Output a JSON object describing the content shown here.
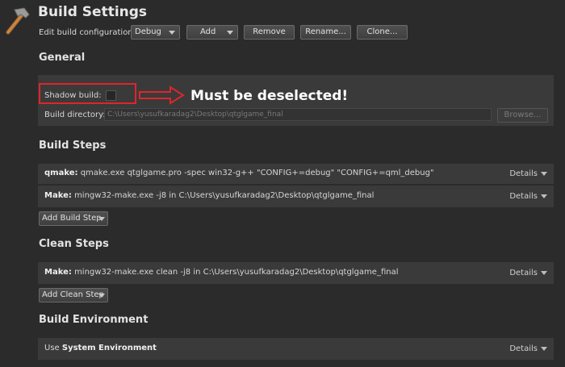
{
  "header": {
    "title": "Build Settings",
    "config_label": "Edit build configuration:",
    "config_value": "Debug",
    "add_label": "Add",
    "remove_label": "Remove",
    "rename_label": "Rename...",
    "clone_label": "Clone..."
  },
  "general": {
    "heading": "General",
    "shadow_build_label": "Shadow build:",
    "shadow_build_checked": false,
    "build_dir_label": "Build directory:",
    "build_dir_value": "C:\\Users\\yusufkaradag2\\Desktop\\qtglgame_final",
    "browse_label": "Browse..."
  },
  "annotation": {
    "callout_text": "Must be deselected!",
    "color": "#e0252b"
  },
  "build_steps": {
    "heading": "Build Steps",
    "steps": [
      {
        "name": "qmake:",
        "command": "qmake.exe qtglgame.pro -spec win32-g++ \"CONFIG+=debug\" \"CONFIG+=qml_debug\"",
        "details": "Details"
      },
      {
        "name": "Make:",
        "command": "mingw32-make.exe -j8 in C:\\Users\\yusufkaradag2\\Desktop\\qtglgame_final",
        "details": "Details"
      }
    ],
    "add_label": "Add Build Step"
  },
  "clean_steps": {
    "heading": "Clean Steps",
    "steps": [
      {
        "name": "Make:",
        "command": "mingw32-make.exe clean -j8 in C:\\Users\\yusufkaradag2\\Desktop\\qtglgame_final",
        "details": "Details"
      }
    ],
    "add_label": "Add Clean Step"
  },
  "build_env": {
    "heading": "Build Environment",
    "prefix": "Use",
    "value": "System Environment",
    "details": "Details"
  },
  "icons": {
    "hammer": "hammer-icon",
    "dropdown": "chevron-down-icon",
    "arrow": "right-arrow-icon"
  }
}
